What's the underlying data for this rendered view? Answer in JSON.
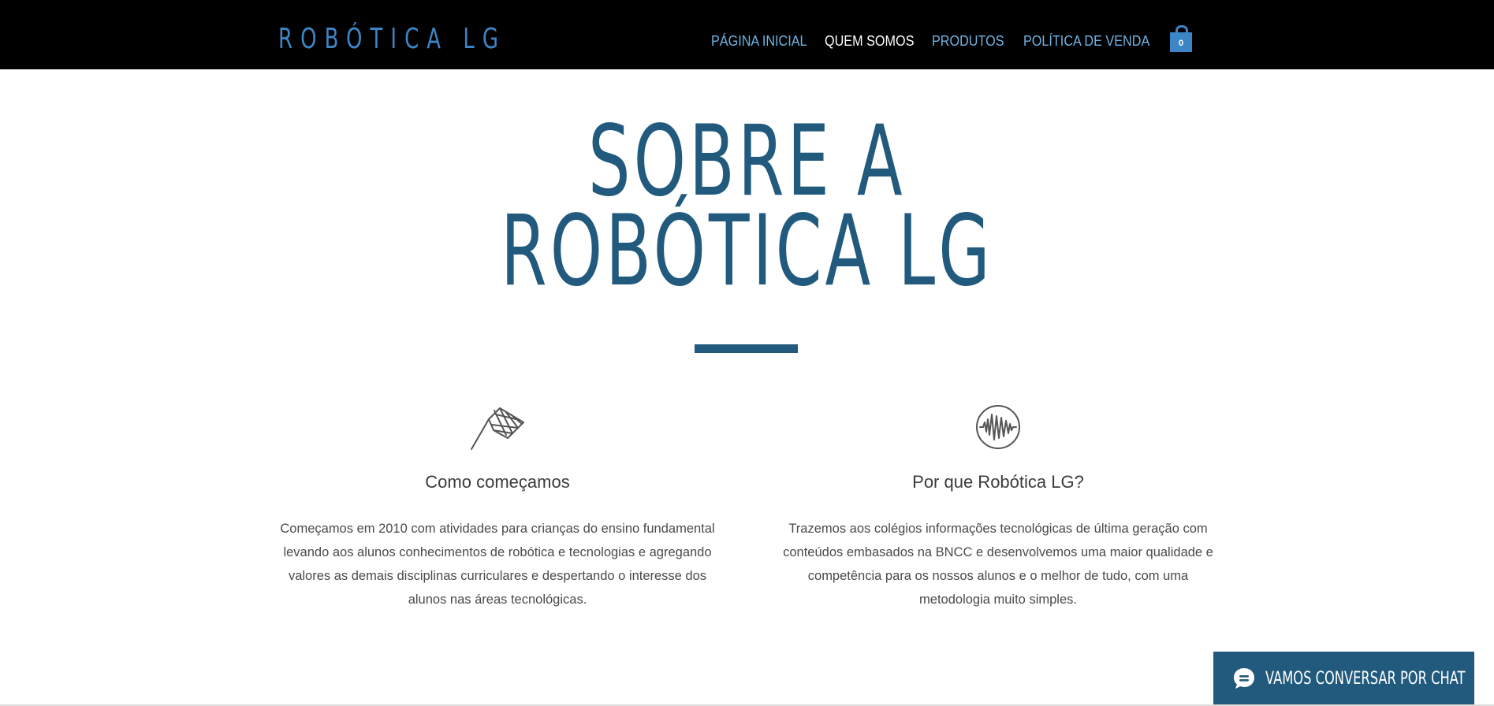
{
  "header": {
    "logo": "ROBÓTICA LG",
    "nav": [
      {
        "label": "PÁGINA INICIAL",
        "active": false
      },
      {
        "label": "QUEM SOMOS",
        "active": true
      },
      {
        "label": "PRODUTOS",
        "active": false
      },
      {
        "label": "POLÍTICA DE VENDA",
        "active": false
      }
    ],
    "cart": {
      "icon": "shopping-bag-icon",
      "count": "0"
    }
  },
  "hero": {
    "title_line1": "SOBRE A",
    "title_line2": "ROBÓTICA LG"
  },
  "features": [
    {
      "icon": "checkered-flag-icon",
      "title": "Como começamos",
      "text": "Começamos em 2010 com atividades para crianças do ensino fundamental levando aos alunos conhecimentos de robótica e tecnologias e agregando valores as demais disciplinas curriculares e despertando o interesse dos alunos nas áreas tecnológicas."
    },
    {
      "icon": "sound-wave-icon",
      "title": "Por que Robótica LG?",
      "text": "Trazemos aos colégios informações tecnológicas de última geração com conteúdos embasados na BNCC e desenvolvemos uma maior qualidade e competência para os nossos alunos e o melhor de tudo, com uma metodologia muito simples."
    }
  ],
  "chat": {
    "icon": "chat-bubble-icon",
    "label": "VAMOS CONVERSAR POR CHAT"
  },
  "colors": {
    "header_bg": "#000000",
    "logo": "#3d86c6",
    "nav_link": "#6fb3e4",
    "nav_active": "#ffffff",
    "accent": "#215a7d",
    "text": "#4a4a4a"
  }
}
